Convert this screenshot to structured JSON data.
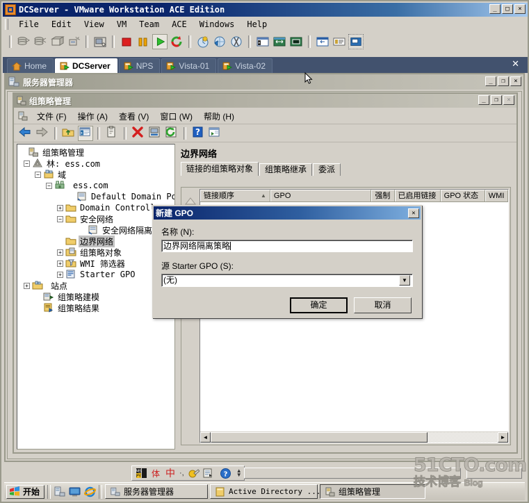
{
  "vmware": {
    "title": "DCServer - VMware Workstation ACE Edition",
    "icon": "vmware-icon",
    "menus": [
      "File",
      "Edit",
      "View",
      "VM",
      "Team",
      "ACE",
      "Windows",
      "Help"
    ],
    "window_buttons": {
      "minimize": "_",
      "maximize": "□",
      "close": "×"
    },
    "toolbar_icons": [
      "snapshot-icon",
      "revert-snapshot-icon",
      "manage-snapshots-icon",
      "clone-icon",
      "capture-screen-icon",
      "power-off-icon",
      "suspend-icon",
      "power-on-icon",
      "reset-icon",
      "new-vm-icon",
      "team-icon",
      "settings-icon",
      "show-sidebar-icon",
      "fit-guest-icon",
      "full-screen-icon",
      "quick-switch-icon",
      "summary-view-icon",
      "console-view-icon"
    ],
    "tabs": [
      {
        "label": "Home",
        "icon": "home-icon",
        "active": false
      },
      {
        "label": "DCServer",
        "icon": "vm-icon",
        "active": true
      },
      {
        "label": "NPS",
        "icon": "vm-icon",
        "active": false
      },
      {
        "label": "Vista-01",
        "icon": "vm-icon",
        "active": false
      },
      {
        "label": "Vista-02",
        "icon": "vm-icon",
        "active": false
      }
    ],
    "tab_close_label": "✕"
  },
  "server_manager": {
    "title": "服务器管理器",
    "icon": "server-manager-icon",
    "window_buttons": {
      "minimize": "_",
      "restore": "❐",
      "close": "×"
    }
  },
  "gpm": {
    "title": "组策略管理",
    "icon": "gpm-icon",
    "window_buttons": {
      "minimize": "_",
      "restore": "❐",
      "close": "×"
    },
    "menus": [
      "文件 (F)",
      "操作 (A)",
      "查看 (V)",
      "窗口 (W)",
      "帮助 (H)"
    ],
    "toolbar_icons": [
      "back-arrow-icon",
      "forward-arrow-icon",
      "up-folder-icon",
      "show-tree-icon",
      "properties-icon",
      "delete-icon",
      "report-icon",
      "refresh-icon",
      "help-icon",
      "new-window-icon"
    ],
    "tree": {
      "root": {
        "label": "组策略管理",
        "icon": "gpm-icon"
      },
      "nodes": [
        {
          "label": "林: ess.com",
          "icon": "forest-icon",
          "expander": "−",
          "indent": 1,
          "selected": false
        },
        {
          "label": "域",
          "icon": "domains-icon",
          "expander": "−",
          "indent": 2,
          "selected": false
        },
        {
          "label": "ess.com",
          "icon": "domain-icon",
          "expander": "−",
          "indent": 3,
          "selected": false
        },
        {
          "label": "Default Domain Policy",
          "icon": "gpo-link-icon",
          "expander": "",
          "indent": 5,
          "selected": false
        },
        {
          "label": "Domain Controllers",
          "icon": "ou-icon",
          "expander": "+",
          "indent": 4,
          "selected": false
        },
        {
          "label": "安全网络",
          "icon": "ou-icon",
          "expander": "−",
          "indent": 4,
          "selected": false
        },
        {
          "label": "安全网络隔离策略",
          "icon": "gpo-link-icon",
          "expander": "",
          "indent": 6,
          "selected": false
        },
        {
          "label": "边界网络",
          "icon": "ou-icon",
          "expander": "",
          "indent": 4,
          "selected": true
        },
        {
          "label": "组策略对象",
          "icon": "gpo-folder-icon",
          "expander": "+",
          "indent": 4,
          "selected": false
        },
        {
          "label": "WMI 筛选器",
          "icon": "wmi-filter-icon",
          "expander": "+",
          "indent": 4,
          "selected": false
        },
        {
          "label": "Starter GPO",
          "icon": "starter-gpo-icon",
          "expander": "+",
          "indent": 4,
          "selected": false
        },
        {
          "label": "站点",
          "icon": "sites-icon",
          "expander": "+",
          "indent": 2,
          "selected": false
        },
        {
          "label": "组策略建模",
          "icon": "modeling-icon",
          "expander": "",
          "indent": 2,
          "selected": false
        },
        {
          "label": "组策略结果",
          "icon": "results-icon",
          "expander": "",
          "indent": 2,
          "selected": false
        }
      ]
    },
    "detail": {
      "heading": "边界网络",
      "tabs": [
        {
          "label": "链接的组策略对象",
          "active": true
        },
        {
          "label": "组策略继承",
          "active": false
        },
        {
          "label": "委派",
          "active": false
        }
      ],
      "columns": [
        {
          "label": "链接顺序",
          "width": 104,
          "sort": "▲"
        },
        {
          "label": "GPO",
          "width": 150,
          "sort": ""
        },
        {
          "label": "强制",
          "width": 34,
          "sort": ""
        },
        {
          "label": "已启用链接",
          "width": 68,
          "sort": ""
        },
        {
          "label": "GPO 状态",
          "width": 66,
          "sort": ""
        },
        {
          "label": "WMI",
          "width": 34,
          "sort": ""
        }
      ],
      "rows": [],
      "move_up_icon": "move-up-icon",
      "move_top_icon": "move-to-top-icon",
      "scroll_left_icon": "◄",
      "scroll_right_icon": "►"
    }
  },
  "dialog": {
    "title": "新建 GPO",
    "close_label": "✕",
    "name_label": "名称 (N):",
    "name_value": "边界网络隔离策略",
    "source_label": "源 Starter GPO (S):",
    "source_value": "(无)",
    "dropdown_arrow": "▼",
    "ok_label": "确定",
    "cancel_label": "取消"
  },
  "taskbar": {
    "start_label": "开始",
    "start_icon": "windows-flag-icon",
    "quick_launch": [
      "server-manager-icon",
      "show-desktop-icon",
      "internet-explorer-icon"
    ],
    "buttons": [
      {
        "label": "服务器管理器",
        "icon": "server-manager-icon",
        "pressed": false
      },
      {
        "label": "Active Directory ...",
        "icon": "ad-icon",
        "pressed": false
      },
      {
        "label": "组策略管理",
        "icon": "gpm-icon",
        "pressed": true
      }
    ],
    "language_bar": {
      "icons": [
        "ime-mspy-icon",
        "ime-soft-keyboard-icon"
      ],
      "mode": "中",
      "punct": "·,",
      "extra_icons": [
        "ime-handwriting-icon",
        "ime-pad-icon",
        "ime-help-icon"
      ],
      "menu_arrow": "▼"
    }
  },
  "watermark": {
    "line1": "51CTO.com",
    "line2": "技术博客",
    "line3": "Blog"
  },
  "colors": {
    "title_blue": "#0a246a",
    "title_blue_light": "#a6caf0",
    "face": "#d4d0c8",
    "tabstrip": "#42526e",
    "selection": "#c0c0c0"
  }
}
